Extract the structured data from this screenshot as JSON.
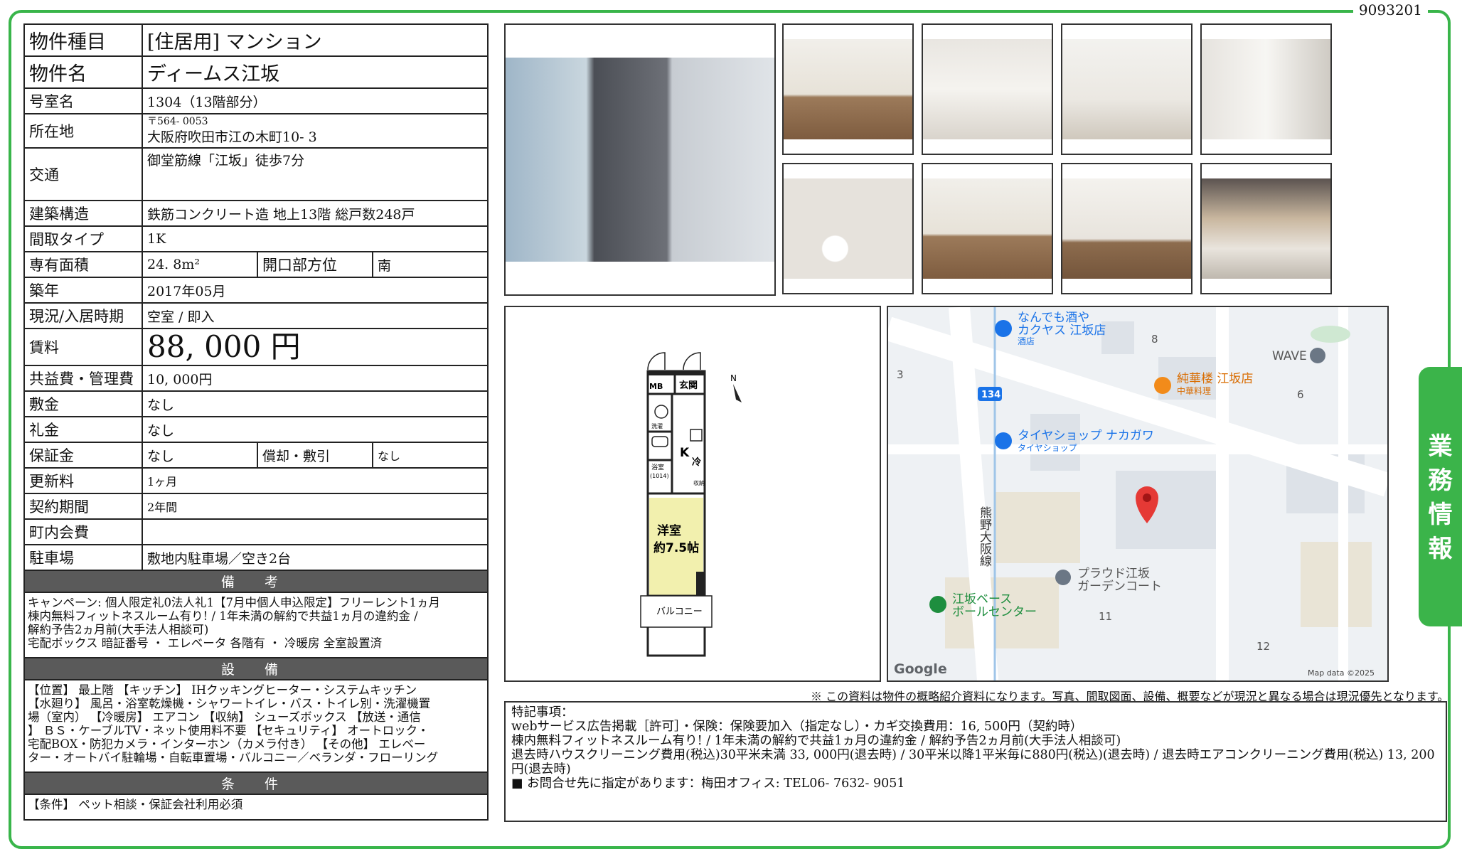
{
  "doc_id": "9093201",
  "rows": {
    "type": {
      "label": "物件種目",
      "value": "[住居用]  マンション"
    },
    "name": {
      "label": "物件名",
      "value": "ディームス江坂"
    },
    "room": {
      "label": "号室名",
      "value": "1304（13階部分）"
    },
    "address": {
      "label": "所在地",
      "zip": "〒564- 0053",
      "value": "大阪府吹田市江の木町10- 3"
    },
    "access": {
      "label": "交通",
      "value": "御堂筋線「江坂」徒歩7分"
    },
    "structure": {
      "label": "建築構造",
      "value": "鉄筋コンクリート造  地上13階  総戸数248戸"
    },
    "layout": {
      "label": "間取タイプ",
      "value": "1K"
    },
    "area": {
      "label": "専有面積",
      "value": "24. 8m²",
      "dir_label": "開口部方位",
      "dir_value": "南"
    },
    "built": {
      "label": "築年",
      "value": "2017年05月"
    },
    "status": {
      "label": "現況/入居時期",
      "value": "空室  /  即入"
    },
    "rent": {
      "label": "賃料",
      "value": "88, 000  円"
    },
    "fee": {
      "label": "共益費・管理費",
      "value": "10, 000円"
    },
    "deposit": {
      "label": "敷金",
      "value": "なし"
    },
    "key_money": {
      "label": "礼金",
      "value": "なし"
    },
    "guarantee": {
      "label": "保証金",
      "value": "なし",
      "amort_label": "償却・敷引",
      "amort_value": "なし"
    },
    "renewal": {
      "label": "更新料",
      "value": "1ヶ月"
    },
    "term": {
      "label": "契約期間",
      "value": "2年間"
    },
    "town_fee": {
      "label": "町内会費",
      "value": ""
    },
    "parking": {
      "label": "駐車場",
      "value": "敷地内駐車場／空き2台"
    }
  },
  "remarks": {
    "title": "備 考",
    "lines": [
      "キャンペーン: 個人限定礼0法人礼1【7月中個人申込限定】フリーレント1ヵ月",
      "棟内無料フィットネスルーム有り!  /  1年未満の解約で共益1ヵ月の違約金  /",
      "解約予告2ヵ月前(大手法人相談可)",
      "宅配ボックス  暗証番号  ・  エレベータ  各階有  ・  冷暖房  全室設置済"
    ]
  },
  "facilities": {
    "title": "設 備",
    "lines": [
      "【位置】 最上階 【キッチン】 IHクッキングヒーター・システムキッチン",
      "【水廻り】  風呂・浴室乾燥機・シャワートイレ・バス・トイレ別・洗濯機置",
      "場（室内） 【冷暖房】 エアコン 【収納】 シューズボックス 【放送・通信",
      "】  ＢＳ・ケーブルTV・ネット使用料不要 【セキュリティ】 オートロック・",
      "宅配BOX・防犯カメラ・インターホン（カメラ付き） 【その他】 エレベー",
      "ター・オートバイ駐輪場・自転車置場・バルコニー／ベランダ・フローリング"
    ]
  },
  "conditions": {
    "title": "条 件",
    "lines": [
      "【条件】 ペット相談・保証会社利用必須"
    ]
  },
  "photos": [
    {
      "name": "building-exterior-photo",
      "kind": "bldg"
    },
    {
      "name": "room-photo",
      "kind": "room"
    },
    {
      "name": "kitchen-photo",
      "kind": "kitchen"
    },
    {
      "name": "bathroom-photo",
      "kind": "bath"
    },
    {
      "name": "washroom-photo",
      "kind": "vanity"
    },
    {
      "name": "toilet-photo",
      "kind": "toilet"
    },
    {
      "name": "room-photo-2",
      "kind": "room"
    },
    {
      "name": "closet-photo",
      "kind": "closet"
    },
    {
      "name": "lobby-photo",
      "kind": "lobby"
    }
  ],
  "floor_plan": {
    "mb": "MB",
    "entrance": "玄関",
    "kitchen": "K",
    "fridge": "冷",
    "washer": "洗濯",
    "bath": "浴室",
    "bath_size": "(1014)",
    "storage": "収納",
    "western": "洋室",
    "western_size": "約7.5帖",
    "balcony": "バルコニー",
    "north": "N"
  },
  "map": {
    "labels": {
      "shop1_a": "なんでも酒や",
      "shop1_b": "カクヤス 江坂店",
      "shop1_c": "酒店",
      "shop2_a": "純華楼 江坂店",
      "shop2_b": "中華料理",
      "wave": "WAVE",
      "tire_a": "タイヤショップ ナカガワ",
      "tire_b": "タイヤショップ",
      "proud_a": "プラウド江坂",
      "proud_b": "ガーデンコート",
      "bowl_a": "江坂ベース",
      "bowl_b": "ボールセンター",
      "road_vertical": "熊野大阪線",
      "route": "134",
      "n3": "3",
      "n6": "6",
      "n8": "8",
      "n11": "11",
      "n12": "12",
      "google": "Google",
      "mapdata": "Map data ©2025"
    },
    "colors": {
      "pin": "#e53935",
      "road": "#ffffff",
      "base": "#eef1f4",
      "park": "#cfe8d2",
      "blue": "#1a73e8"
    }
  },
  "note": "※ この資料は物件の概略紹介資料になります。写真、間取図面、設備、概要などが現況と異なる場合は現況優先となります。",
  "special": {
    "title": "特記事項：",
    "lines": [
      "webサービス広告掲載［許可］・保険：保険要加入（指定なし）・カギ交換費用：16, 500円（契約時）",
      "棟内無料フィットネスルーム有り!  /  1年未満の解約で共益1ヵ月の違約金  /  解約予告2ヵ月前(大手法人相談可)",
      "退去時ハウスクリーニング費用(税込)30平米未満  33, 000円(退去時)  /  30平米以降1平米毎に880円(税込)(退去時)  /  退去時エアコンクリーニング費用(税込)  13, 200円(退去時)",
      "■  お問合せ先に指定があります：梅田オフィス: TEL06- 7632- 9051"
    ]
  },
  "side_tab": [
    "業",
    "務",
    "情",
    "報"
  ],
  "colors": {
    "frame": "#39b54a",
    "section_bar": "#5a5a5a"
  }
}
